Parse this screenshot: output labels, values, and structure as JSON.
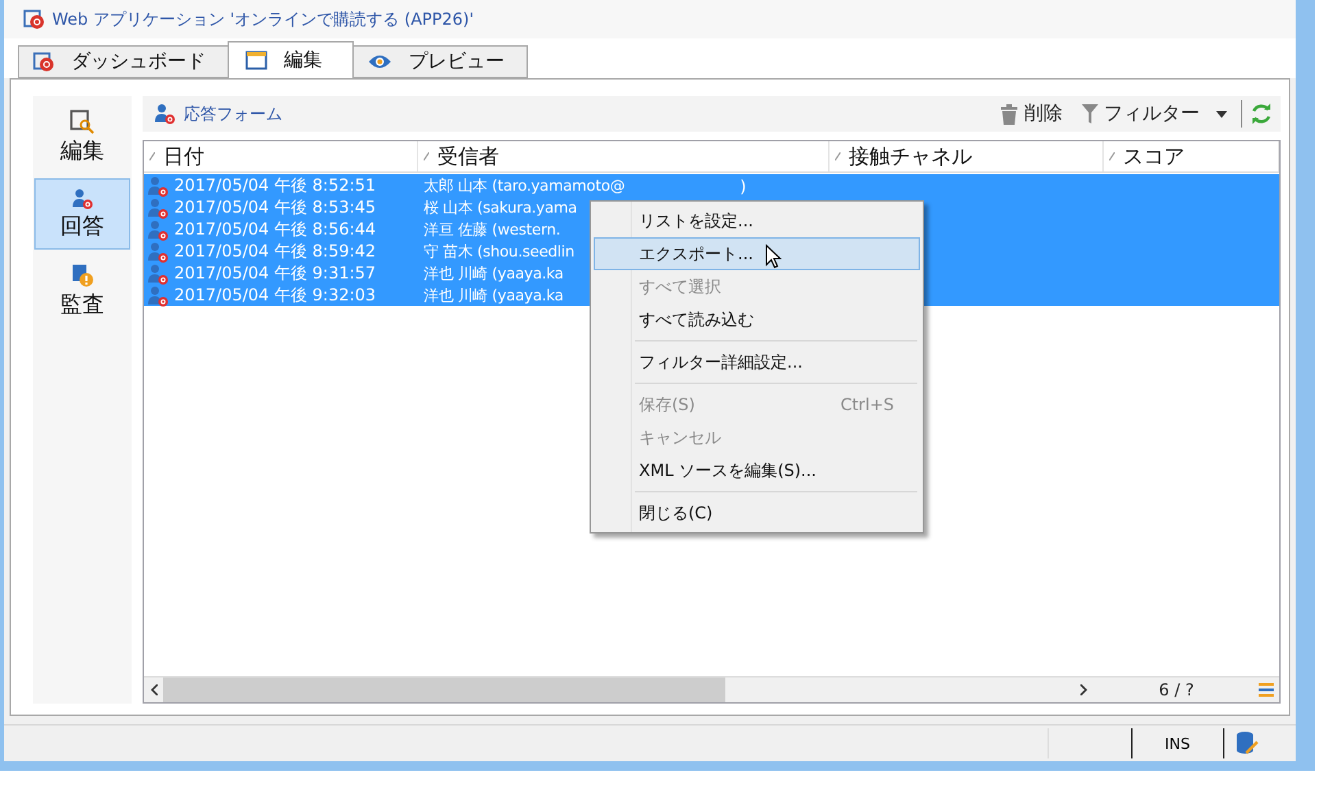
{
  "window": {
    "title": "Web アプリケーション 'オンラインで購読する (APP26)'"
  },
  "tabs": [
    {
      "label": "ダッシュボード",
      "selected": false
    },
    {
      "label": "編集",
      "selected": true
    },
    {
      "label": "プレビュー",
      "selected": false
    }
  ],
  "sidebar": {
    "items": [
      {
        "label": "編集",
        "selected": false
      },
      {
        "label": "回答",
        "selected": true
      },
      {
        "label": "監査",
        "selected": false
      }
    ]
  },
  "toolbar": {
    "title": "応答フォーム",
    "delete": "削除",
    "filter": "フィルター"
  },
  "table": {
    "columns": [
      "日付",
      "受信者",
      "接触チャネル",
      "スコア"
    ],
    "rows": [
      {
        "date": "2017/05/04 午後 8:52:51",
        "recipient": "太郎 山本 (taro.yamamoto@",
        "recipient_tail": ")",
        "selected": true
      },
      {
        "date": "2017/05/04 午後 8:53:45",
        "recipient": "桜 山本 (sakura.yama",
        "selected": true
      },
      {
        "date": "2017/05/04 午後 8:56:44",
        "recipient": "洋亘 佐藤 (western.",
        "selected": true
      },
      {
        "date": "2017/05/04 午後 8:59:42",
        "recipient": "守 苗木 (shou.seedlin",
        "selected": true
      },
      {
        "date": "2017/05/04 午後 9:31:57",
        "recipient": "洋也 川崎 (yaaya.ka",
        "selected": true
      },
      {
        "date": "2017/05/04 午後 9:32:03",
        "recipient": "洋也 川崎 (yaaya.ka",
        "selected": true
      }
    ],
    "pager": "6 / ?"
  },
  "context_menu": [
    {
      "kind": "item",
      "label": "リストを設定...",
      "disabled": false,
      "selected": false
    },
    {
      "kind": "item",
      "label": "エクスポート...",
      "disabled": false,
      "selected": true
    },
    {
      "kind": "item",
      "label": "すべて選択",
      "disabled": true,
      "selected": false
    },
    {
      "kind": "item",
      "label": "すべて読み込む",
      "disabled": false,
      "selected": false
    },
    {
      "kind": "separator"
    },
    {
      "kind": "item",
      "label": "フィルター詳細設定...",
      "disabled": false,
      "selected": false
    },
    {
      "kind": "separator"
    },
    {
      "kind": "item",
      "label": "保存(S)",
      "shortcut": "Ctrl+S",
      "disabled": true,
      "selected": false
    },
    {
      "kind": "item",
      "label": "キャンセル",
      "disabled": true,
      "selected": false
    },
    {
      "kind": "item",
      "label": "XML ソースを編集(S)...",
      "disabled": false,
      "selected": false
    },
    {
      "kind": "separator"
    },
    {
      "kind": "item",
      "label": "閉じる(C)",
      "disabled": false,
      "selected": false
    }
  ],
  "status_bar": {
    "mode": "INS"
  }
}
